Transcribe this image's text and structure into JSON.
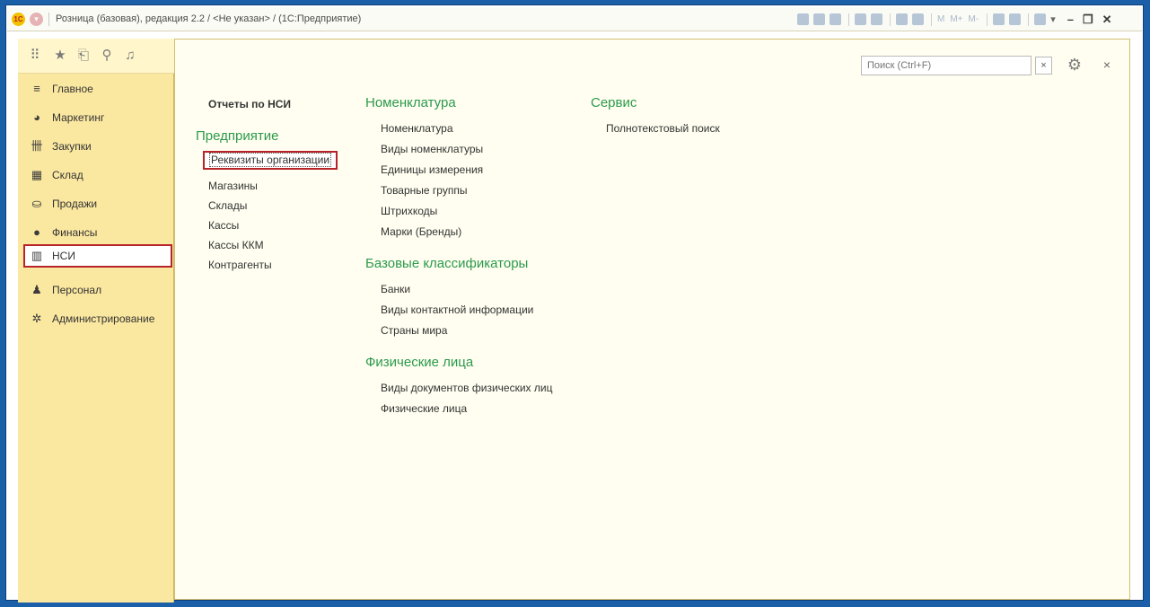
{
  "window": {
    "logo": "1С",
    "title": "Розница (базовая), редакция 2.2 / <Не указан> / (1С:Предприятие)",
    "toolbar_text": [
      "M",
      "M+",
      "M-"
    ]
  },
  "sidebar": {
    "quick_icons": [
      "apps-grid-icon",
      "star-icon",
      "history-icon",
      "search-icon",
      "bell-icon"
    ],
    "sections": [
      {
        "label": "Главное",
        "icon": "menu-lines-icon",
        "glyph": "≡"
      },
      {
        "label": "Маркетинг",
        "icon": "pie-chart-icon",
        "glyph": "◕"
      },
      {
        "label": "Закупки",
        "icon": "cart-icon",
        "glyph": "卌"
      },
      {
        "label": "Склад",
        "icon": "warehouse-icon",
        "glyph": "▦"
      },
      {
        "label": "Продажи",
        "icon": "basket-icon",
        "glyph": "⛀"
      },
      {
        "label": "Финансы",
        "icon": "finance-icon",
        "glyph": "●"
      },
      {
        "label": "НСИ",
        "icon": "books-icon",
        "glyph": "▥",
        "active": true
      },
      {
        "label": "Персонал",
        "icon": "person-icon",
        "glyph": "♟"
      },
      {
        "label": "Администрирование",
        "icon": "gear-icon",
        "glyph": "✲"
      }
    ]
  },
  "content": {
    "search": {
      "placeholder": "Поиск (Ctrl+F)",
      "clear": "×"
    },
    "close": "×",
    "col1": {
      "reports_title": "Отчеты по НСИ",
      "group_title": "Предприятие",
      "items": [
        "Реквизиты организации",
        "Магазины",
        "Склады",
        "Кассы",
        "Кассы ККМ",
        "Контрагенты"
      ]
    },
    "col2": {
      "groups": [
        {
          "title": "Номенклатура",
          "items": [
            "Номенклатура",
            "Виды номенклатуры",
            "Единицы измерения",
            "Товарные группы",
            "Штрихкоды",
            "Марки (Бренды)"
          ]
        },
        {
          "title": "Базовые классификаторы",
          "items": [
            "Банки",
            "Виды контактной информации",
            "Страны мира"
          ]
        },
        {
          "title": "Физические лица",
          "items": [
            "Виды документов физических лиц",
            "Физические лица"
          ]
        }
      ]
    },
    "col3": {
      "groups": [
        {
          "title": "Сервис",
          "items": [
            "Полнотекстовый поиск"
          ]
        }
      ]
    }
  },
  "colors": {
    "accent": "#2b9a4c",
    "highlight": "#b8232a",
    "sidebar": "#fbe8a0",
    "content_bg": "#fffef0"
  }
}
